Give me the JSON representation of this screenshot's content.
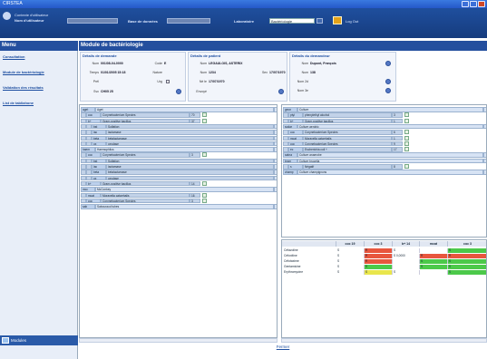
{
  "window": {
    "title": "CIRSTEA"
  },
  "topbar": {
    "user_label_1": "Contexte d'utilisateur",
    "user_label_2": "Nom d'utilisateur",
    "db_label": "Base de données",
    "lab_label": "Laboratoire",
    "lab_value": "Bactériologie",
    "logout": "Log Out"
  },
  "menu": {
    "title": "Menu",
    "items": [
      "Consultation",
      "Module de bactériologie",
      "Validation des résultats",
      "List de tabliahone"
    ],
    "modules": "Modules"
  },
  "main": {
    "title": "Module de bactériologie"
  },
  "demande": {
    "title": "Détails de demande",
    "fields": [
      {
        "label": "Num",
        "value": "001/08-04-0000"
      },
      {
        "label": "Code",
        "value": "E"
      },
      {
        "label": "Temps",
        "value": "01/01/2005 15:18"
      },
      {
        "label": "Nature",
        "value": ""
      },
      {
        "label": "Prél",
        "value": ""
      },
      {
        "label": "Urg",
        "value": ""
      },
      {
        "label": "Svc",
        "value": "CH05 25"
      }
    ]
  },
  "patient": {
    "title": "Détails de patient",
    "fields": [
      {
        "label": "Nom",
        "value": "LEGAULOIS, ASTERIX"
      },
      {
        "label": "Num",
        "value": "1234"
      },
      {
        "label": "Sex",
        "value": "M"
      },
      {
        "label": "Né le",
        "value": "17/07/1970"
      },
      {
        "label": "Envoyé",
        "value": ""
      }
    ]
  },
  "demandeur": {
    "title": "Détails du demandeur",
    "fields": [
      {
        "label": "Nom",
        "value": "Dupont, François"
      },
      {
        "label": "Num",
        "value": "138"
      },
      {
        "label": "Nom 2d",
        "value": ""
      },
      {
        "label": "Nom 3e",
        "value": ""
      }
    ]
  },
  "left_tree": [
    {
      "d": 0,
      "a": "aget",
      "b": "Aget"
    },
    {
      "d": 1,
      "a": "coc",
      "b": "Corynebacterium Species",
      "n": "70",
      "c": true
    },
    {
      "d": 1,
      "a": "b+",
      "b": "Gram-positive bacillus",
      "n": "37",
      "c": true
    },
    {
      "d": 2,
      "a": "bst",
      "b": "Sulfation"
    },
    {
      "d": 2,
      "a": "lac",
      "b": "lactamase"
    },
    {
      "d": 2,
      "a": "beta",
      "b": "betalactamase"
    },
    {
      "d": 2,
      "a": "ox",
      "b": "oxydase"
    },
    {
      "d": 0,
      "a": "haem",
      "b": "Haemophilus"
    },
    {
      "d": 1,
      "a": "coc",
      "b": "Corynebacterium Species",
      "n": "3",
      "c": true
    },
    {
      "d": 2,
      "a": "bst",
      "b": "Sulfation"
    },
    {
      "d": 2,
      "a": "lac",
      "b": "lactamase"
    },
    {
      "d": 2,
      "a": "beta",
      "b": "betalactamase"
    },
    {
      "d": 2,
      "a": "ox",
      "b": "oxydase"
    },
    {
      "d": 1,
      "a": "b+",
      "b": "Gram-positive bacillus",
      "n": "14",
      "c": true
    },
    {
      "d": 0,
      "a": "mcc",
      "b": "McConkey"
    },
    {
      "d": 1,
      "a": "mcat",
      "b": "Moraxella catarrhalis",
      "n": "16",
      "c": true
    },
    {
      "d": 1,
      "a": "coc",
      "b": "Corynebacterium Species",
      "n": "3",
      "c": true
    },
    {
      "d": 0,
      "a": "sab",
      "b": "Sabouraud tubes"
    }
  ],
  "right_tree": [
    {
      "d": 0,
      "a": "geon",
      "b": "Culture"
    },
    {
      "d": 1,
      "a": "ptyl",
      "b": "phenylethyl alcohol",
      "n": "3",
      "c": true
    },
    {
      "d": 1,
      "a": "b+",
      "b": "Gram-positive bacillus",
      "n": "1",
      "c": true
    },
    {
      "d": 0,
      "a": "sodar",
      "b": "Culture aerobic"
    },
    {
      "d": 1,
      "a": "coc",
      "b": "Corynebacterium Species",
      "n": "6",
      "c": true
    },
    {
      "d": 1,
      "a": "mcat",
      "b": "Moraxella catarrhalis",
      "n": "1",
      "c": true
    },
    {
      "d": 1,
      "a": "coc",
      "b": "Corynebacterium Species",
      "n": "9",
      "c": true
    },
    {
      "d": 1,
      "a": "ec",
      "b": "Escherichia coli +",
      "n": "17",
      "c": true
    },
    {
      "d": 0,
      "a": "sabra",
      "b": "Culture anaerobe"
    },
    {
      "d": 0,
      "a": "brcm",
      "b": "Culture brucella"
    },
    {
      "d": 1,
      "a": "s",
      "b": "Négatif",
      "n": "8",
      "c": true
    },
    {
      "d": 0,
      "a": "champ",
      "b": "Culture champignons"
    }
  ],
  "grid": {
    "headers": [
      "coc 19",
      "coc 3",
      "b+ 14",
      "mcat",
      "coc 3"
    ],
    "rows": [
      {
        "name": "Céfazoline",
        "cells": [
          {
            "t": "S",
            "k": "w"
          },
          {
            "t": "R",
            "k": "r"
          },
          {
            "t": "S",
            "k": "w"
          },
          {
            "t": "",
            "k": "w"
          },
          {
            "t": "S",
            "k": "g"
          }
        ]
      },
      {
        "name": "Céfoxitine",
        "cells": [
          {
            "t": "S",
            "k": "w"
          },
          {
            "t": "R",
            "k": "r"
          },
          {
            "t": "S 0,0000",
            "k": "w"
          },
          {
            "t": "R",
            "k": "r"
          },
          {
            "t": "R",
            "k": "r"
          }
        ]
      },
      {
        "name": "Céfotaxime",
        "cells": [
          {
            "t": "S",
            "k": "w"
          },
          {
            "t": "R",
            "k": "r"
          },
          {
            "t": "",
            "k": "w"
          },
          {
            "t": "S",
            "k": "g"
          },
          {
            "t": "S",
            "k": "g"
          }
        ]
      },
      {
        "name": "Gentamicine",
        "cells": [
          {
            "t": "S",
            "k": "w"
          },
          {
            "t": "S",
            "k": "g"
          },
          {
            "t": "",
            "k": "w"
          },
          {
            "t": "S",
            "k": "g"
          },
          {
            "t": "S",
            "k": "g"
          }
        ]
      },
      {
        "name": "Erythromycine",
        "cells": [
          {
            "t": "S",
            "k": "w"
          },
          {
            "t": "S",
            "k": "y"
          },
          {
            "t": "S",
            "k": "w"
          },
          {
            "t": "",
            "k": "w"
          },
          {
            "t": "S",
            "k": "g"
          }
        ]
      }
    ]
  },
  "footer": {
    "link": "Fermer"
  }
}
